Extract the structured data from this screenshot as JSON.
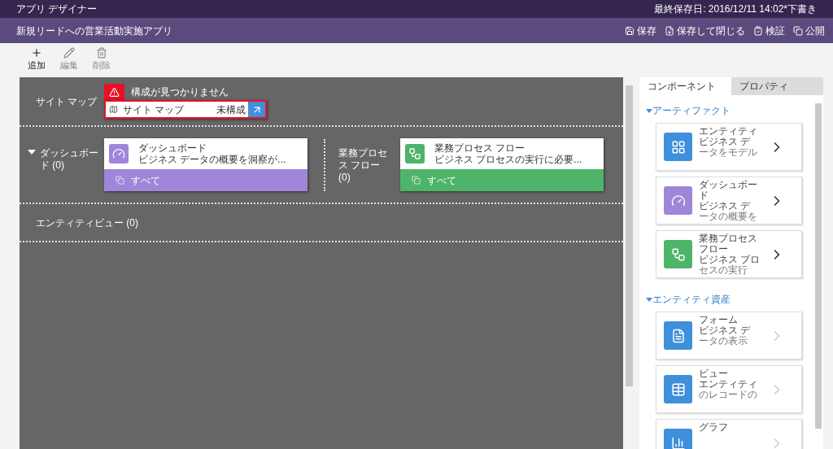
{
  "app_bar": {
    "title": "アプリ デザイナー",
    "last_saved": "最終保存日: 2016/12/11 14:02*下書き"
  },
  "header": {
    "title": "新規リードへの営業活動実施アプリ",
    "actions": [
      {
        "kind": "save",
        "label": "保存"
      },
      {
        "kind": "save-close",
        "label": "保存して閉じる"
      },
      {
        "kind": "validate",
        "label": "検証"
      },
      {
        "kind": "publish",
        "label": "公開"
      }
    ]
  },
  "toolbar": [
    {
      "kind": "add",
      "label": "追加",
      "disabled": false
    },
    {
      "kind": "edit",
      "label": "編集",
      "disabled": true
    },
    {
      "kind": "delete",
      "label": "削除",
      "disabled": true
    }
  ],
  "site_map": {
    "label": "サイト マップ",
    "error": "構成が見つかりません",
    "name": "サイト マップ",
    "status": "未構成"
  },
  "dashboards": {
    "label": "ダッシュボード (0)",
    "expanded": true,
    "card": {
      "title": "ダッシュボード",
      "description": "ビジネス データの概要を洞察が...",
      "footer": "すべて"
    }
  },
  "process_flows": {
    "label": "業務プロセス フロー (0)",
    "card": {
      "title": "業務プロセス フロー",
      "description": "ビジネス プロセスの実行に必要...",
      "footer": "すべて"
    }
  },
  "entity_view": {
    "label": "エンティティビュー (0)"
  },
  "panel": {
    "tabs": [
      {
        "label": "コンポーネント",
        "selected": true
      },
      {
        "label": "プロパティ",
        "selected": false
      }
    ],
    "sections": [
      {
        "title": "アーティファクト",
        "expanded": true,
        "items": [
          {
            "kind": "entity",
            "lines": [
              "エンティティ",
              "ビジネス デ",
              "ータをモデル"
            ],
            "disabled": false
          },
          {
            "kind": "dashboard",
            "lines": [
              "ダッシュボー",
              "ド",
              "ビジネス デ",
              "ータの概要を"
            ],
            "disabled": false
          },
          {
            "kind": "flow",
            "lines": [
              "業務プロセス",
              "フロー",
              "ビジネス プロ",
              "セスの実行"
            ],
            "disabled": false
          }
        ]
      },
      {
        "title": "エンティティ資産",
        "expanded": true,
        "items": [
          {
            "kind": "form",
            "lines": [
              "フォーム",
              "ビジネス デ",
              "ータの表示"
            ],
            "disabled": true
          },
          {
            "kind": "view",
            "lines": [
              "ビュー",
              "エンティティ",
              "のレコードの"
            ],
            "disabled": true
          },
          {
            "kind": "chart",
            "lines": [
              "グラフ"
            ],
            "disabled": true
          }
        ]
      }
    ]
  }
}
